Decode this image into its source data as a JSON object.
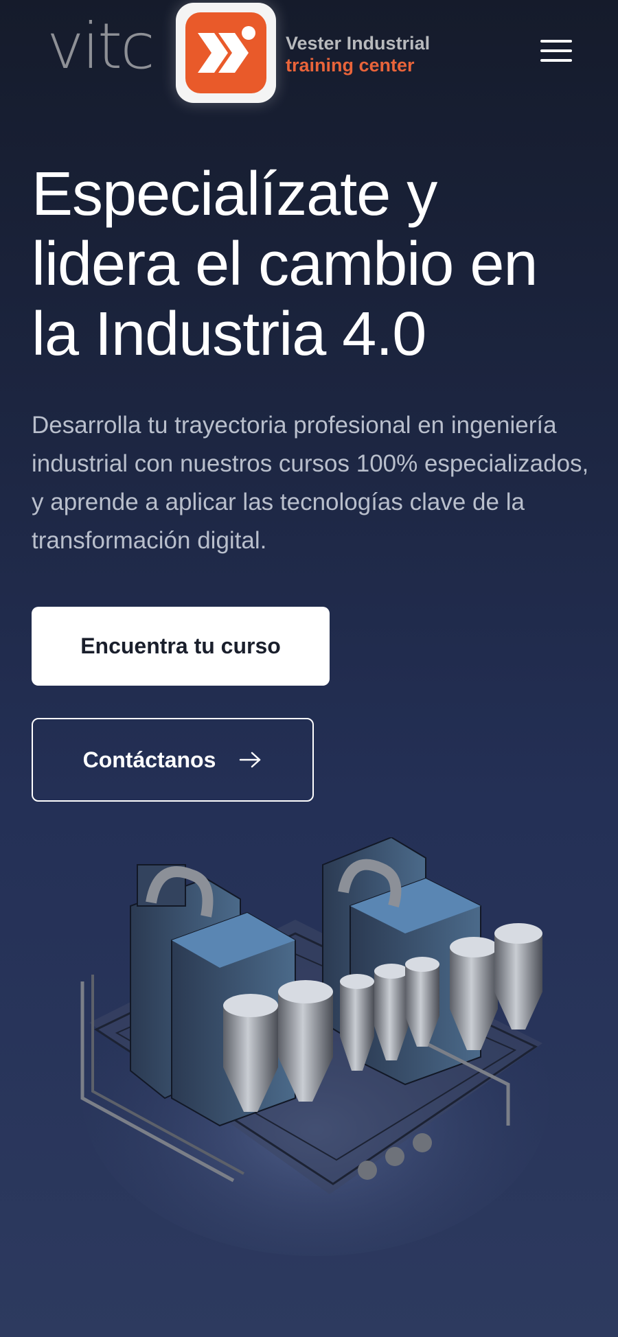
{
  "header": {
    "logo": {
      "wordmark": "vitc",
      "line1": "Vester Industrial",
      "line2": "training center",
      "badge_color": "#e95a2a"
    },
    "menu_icon": "hamburger-menu-icon"
  },
  "hero": {
    "title": "Especialízate y lidera el cambio en la Industria 4.0",
    "description": "Desarrolla tu trayectoria profesional en ingeniería industrial con nuestros cursos 100% especializados, y aprende a aplicar las tecnologías clave de la transformación digital.",
    "primary_button": "Encuentra tu curso",
    "secondary_button": "Contáctanos",
    "secondary_button_icon": "arrow-right-icon",
    "illustration": "industrial-plant-illustration"
  },
  "colors": {
    "background_top": "#151b2b",
    "background_bottom": "#2d3a5f",
    "accent": "#e95a2a"
  }
}
